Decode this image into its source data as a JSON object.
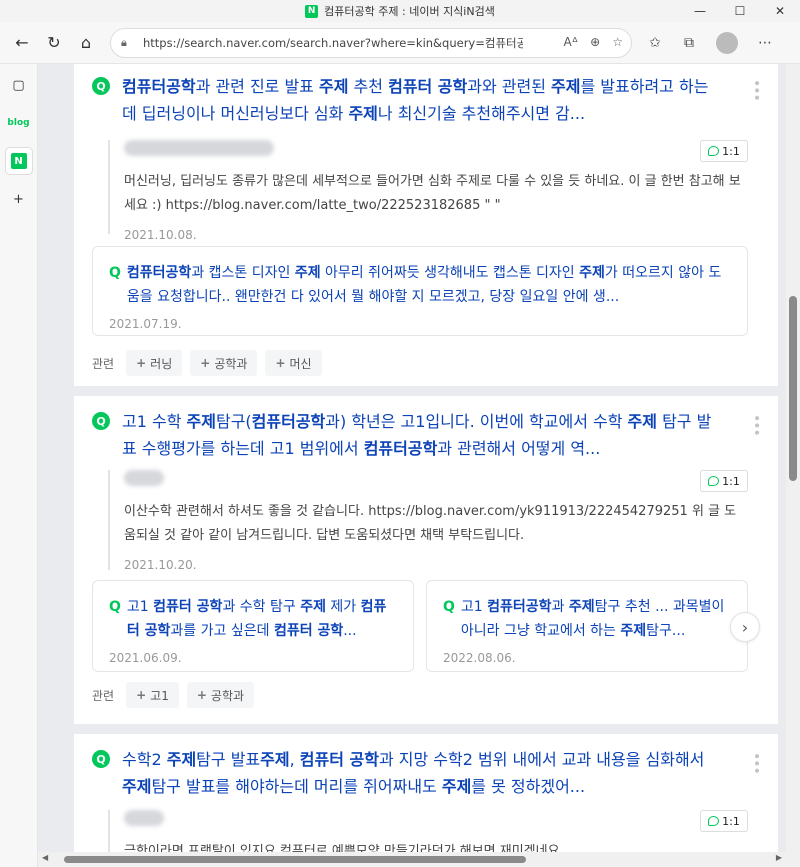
{
  "window": {
    "title": "컴퓨터공학 주제 : 네이버 지식iN검색",
    "minimize": "—",
    "maximize": "☐",
    "close": "✕"
  },
  "address": {
    "url": "https://search.naver.com/search.naver?where=kin&query=컴퓨터공학+..."
  },
  "sidebar": {
    "blog_label": "blog",
    "naver_label": "N",
    "add_label": "+"
  },
  "results": [
    {
      "title_html": "<b>컴퓨터공학</b>과 관련 진로 발표 <b>주제</b> 추천 <b>컴퓨터 공학</b>과와 관련된 <b>주제</b>를 발표하려고 하는데 딥러닝이나 머신러닝보다 심화 <b>주제</b>나 최신기술 추천해주시면 감...",
      "answer_text": "머신러닝, 딥러닝도 종류가 많은데 세부적으로 들어가면 심화 주제로 다룰 수 있을 듯 하네요. 이 글 한번 참고해 보세요 :) https://blog.naver.com/latte_two/222523182685 \" \"",
      "answer_date": "2021.10.08.",
      "one_label": "1:1",
      "related_cards": [
        {
          "text_html": "<b>컴퓨터공학</b>과 캡스톤 디자인 <b>주제</b> 아무리 쥐어짜듯 생각해내도 캡스톤 디자인 <b>주제</b>가 떠오르지 않아 도움을 요청합니다.. 왠만한건 다 있어서 뭘 해야할 지 모르겠고, 당장 일요일 안에 생...",
          "date": "2021.07.19."
        }
      ],
      "related_label": "관련",
      "chips": [
        "러닝",
        "공학과",
        "머신"
      ]
    },
    {
      "title_html": "고1 수학 <b>주제</b>탐구(<b>컴퓨터공학</b>과) 학년은 고1입니다. 이번에 학교에서 수학 <b>주제</b> 탐구 발표 수행평가를 하는데 고1 범위에서 <b>컴퓨터공학</b>과 관련해서 어떻게 역...",
      "answer_text": "이산수학 관련해서 하셔도 좋을 것 같습니다. https://blog.naver.com/yk911913/222454279251 위 글 도움되실 것 같아 같이 남겨드립니다. 답변 도움되셨다면 채택 부탁드립니다.",
      "answer_date": "2021.10.20.",
      "one_label": "1:1",
      "related_cards": [
        {
          "text_html": "고1 <b>컴퓨터 공학</b>과 수학 탐구 <b>주제</b> 제가 <b>컴퓨터 공학</b>과를 가고 싶은데 <b>컴퓨터 공학</b>...",
          "date": "2021.06.09."
        },
        {
          "text_html": "고1 <b>컴퓨터공학</b>과 <b>주제</b>탐구 추천 ... 과목별이아니라 그냥 학교에서 하는 <b>주제</b>탐구...",
          "date": "2022.08.06."
        }
      ],
      "related_label": "관련",
      "chips": [
        "고1",
        "공학과"
      ]
    },
    {
      "title_html": "수학2 <b>주제</b>탐구 발표<b>주제</b>, <b>컴퓨터 공학</b>과 지망 수학2 범위 내에서 교과 내용을 심화해서 <b>주제</b>탐구 발표를 해야하는데 머리를 쥐어짜내도 <b>주제</b>를 못 정하겠어...",
      "answer_text": "극한이라면 프랙탈이 있지요 컴퓨터로 예쁜모양 만들기라던가 해보면 재미겠네요",
      "one_label": "1:1"
    }
  ],
  "icons": {
    "back": "back-arrow-icon",
    "refresh": "refresh-icon",
    "home": "home-icon",
    "lock": "lock-icon",
    "read_aloud": "read-aloud-icon",
    "zoom": "zoom-icon",
    "favorite_add": "add-favorite-icon",
    "favorites": "favorites-icon",
    "collections": "collections-icon",
    "more": "more-icon"
  },
  "colors": {
    "naver_green": "#03c75a",
    "link_blue": "#0c43b7",
    "bg": "#e9ebee"
  }
}
